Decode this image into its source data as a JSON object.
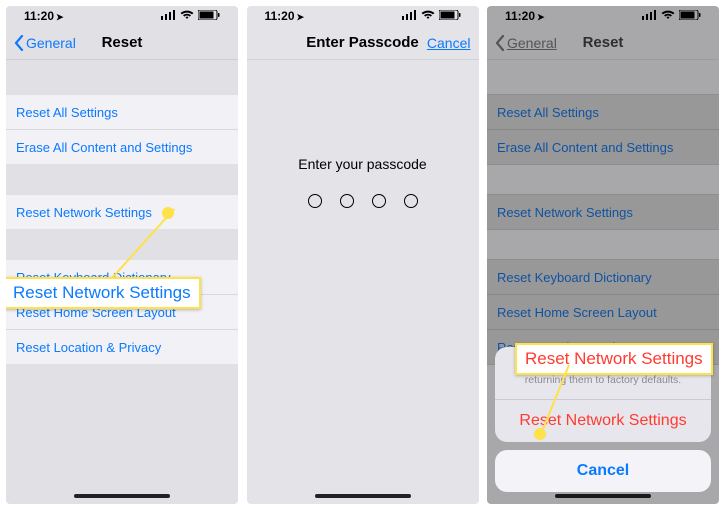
{
  "status": {
    "time": "11:20",
    "location_glyph": "➤"
  },
  "screen1": {
    "back_label": "General",
    "title": "Reset",
    "rows_g1": [
      "Reset All Settings",
      "Erase All Content and Settings"
    ],
    "rows_g2": [
      "Reset Network Settings"
    ],
    "rows_g3": [
      "Reset Keyboard Dictionary",
      "Reset Home Screen Layout",
      "Reset Location & Privacy"
    ],
    "callout": "Reset Network Settings"
  },
  "screen2": {
    "title": "Enter Passcode",
    "cancel": "Cancel",
    "prompt": "Enter your passcode"
  },
  "screen3": {
    "back_label": "General",
    "title": "Reset",
    "rows_g1": [
      "Reset All Settings",
      "Erase All Content and Settings"
    ],
    "rows_g2": [
      "Reset Network Settings"
    ],
    "rows_g3": [
      "Reset Keyboard Dictionary",
      "Reset Home Screen Layout",
      "Reset Location & Privacy"
    ],
    "sheet_msg": "This will delete all network settings, returning them to factory defaults.",
    "sheet_action": "Reset Network Settings",
    "sheet_cancel": "Cancel",
    "callout": "Reset Network Settings"
  }
}
